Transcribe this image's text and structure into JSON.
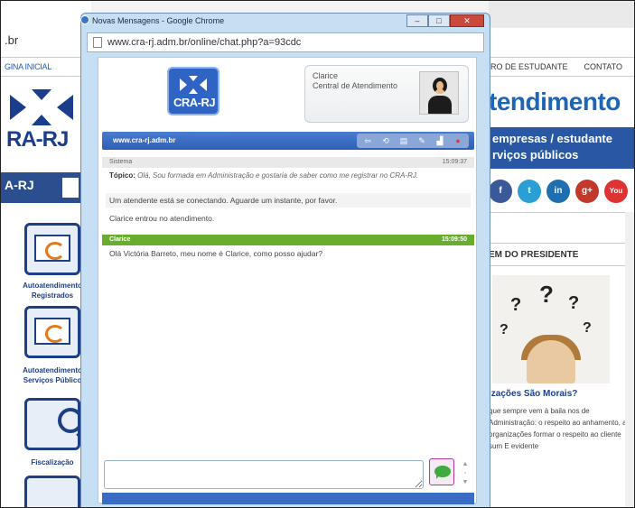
{
  "background_site": {
    "url_fragment": ".br",
    "nav_left": "GINA INICIAL",
    "nav_right": [
      "RO DE ESTUDANTE",
      "CONTATO"
    ],
    "logo_text": "RA-RJ",
    "bar_text": "A-RJ",
    "headline": "tendimento",
    "band_line1": "empresas / estudante",
    "band_line2": "rviços públicos",
    "section_title": "EM DO PRESIDENTE",
    "article_title": "izações São Morais?",
    "article_body": "que sempre vem à baila nos de Administração: o respeito ao anhamento, as organizações formar o respeito ao cliente sum E evidente",
    "tiles": [
      {
        "label": "Autoatendimento Registrados"
      },
      {
        "label": "Autoatendimento Serviços Público"
      },
      {
        "label": "Fiscalização"
      }
    ],
    "social": [
      "f",
      "t",
      "in",
      "g+",
      "You"
    ]
  },
  "window": {
    "title": "Novas Mensagens - Google Chrome",
    "address": "www.cra-rj.adm.br/online/chat.php?a=93cdc",
    "buttons": {
      "minimize": "–",
      "maximize": "□",
      "close": "✕"
    }
  },
  "chat": {
    "logo_text": "CRA-RJ",
    "agent_name": "Clarice",
    "agent_role": "Central de Atendimento",
    "site_label": "www.cra-rj.adm.br",
    "toolbar_icons": [
      "arrow-icon",
      "refresh-icon",
      "print-icon",
      "edit-icon",
      "chart-icon",
      "close-circle-icon"
    ],
    "system_header": "Sistema",
    "system_time": "15:09:37",
    "topic_label": "Tópico:",
    "topic_text": "Olá, Sou formada em Administração e gostaria de saber como me registrar no CRA-RJ.",
    "line_connecting": "Um atendente está se conectando. Aguarde um instante, por favor.",
    "line_entered": "Clarice entrou no atendimento.",
    "agent_header": "Clarice",
    "agent_time": "15:09:50",
    "agent_message": "Olá Victória Barreto, meu nome é Clarice, como posso ajudar?",
    "compose_placeholder": "",
    "accent": "#2e5fb4",
    "agent_color": "#68ad2e"
  }
}
